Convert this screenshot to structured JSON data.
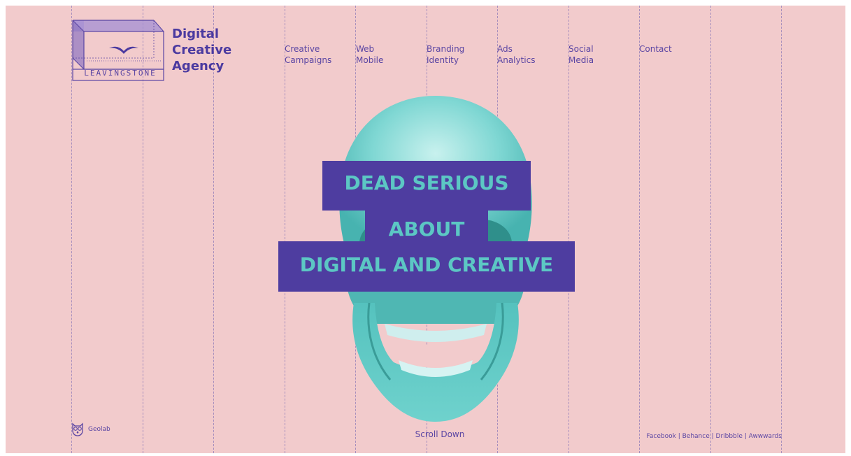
{
  "logo": {
    "wordmark": "LEAVINGSTONE"
  },
  "brand": {
    "line1": "Digital",
    "line2": "Creative",
    "line3": "Agency"
  },
  "nav": [
    {
      "line1": "Creative",
      "line2": "Campaigns"
    },
    {
      "line1": "Web",
      "line2": "Mobile"
    },
    {
      "line1": "Branding",
      "line2": "Identity"
    },
    {
      "line1": "Ads",
      "line2": "Analytics"
    },
    {
      "line1": "Social",
      "line2": "Media"
    },
    {
      "line1": "Contact",
      "line2": ""
    }
  ],
  "hero": {
    "line1": "DEAD SERIOUS",
    "line2": "ABOUT",
    "line3": "DIGITAL AND CREATIVE"
  },
  "footer": {
    "geolab": "Geolab",
    "scroll": "Scroll Down",
    "social": [
      "Facebook",
      "Behance",
      "Dribbble",
      "Awwwards"
    ],
    "separator": "|"
  },
  "icons": {
    "logo_bird": "seagull-icon",
    "geolab": "owl-icon"
  },
  "colors": {
    "background": "#f2cbcc",
    "accent": "#4e3da0",
    "skull": "#62c9c6",
    "text": "#5a45a3"
  }
}
